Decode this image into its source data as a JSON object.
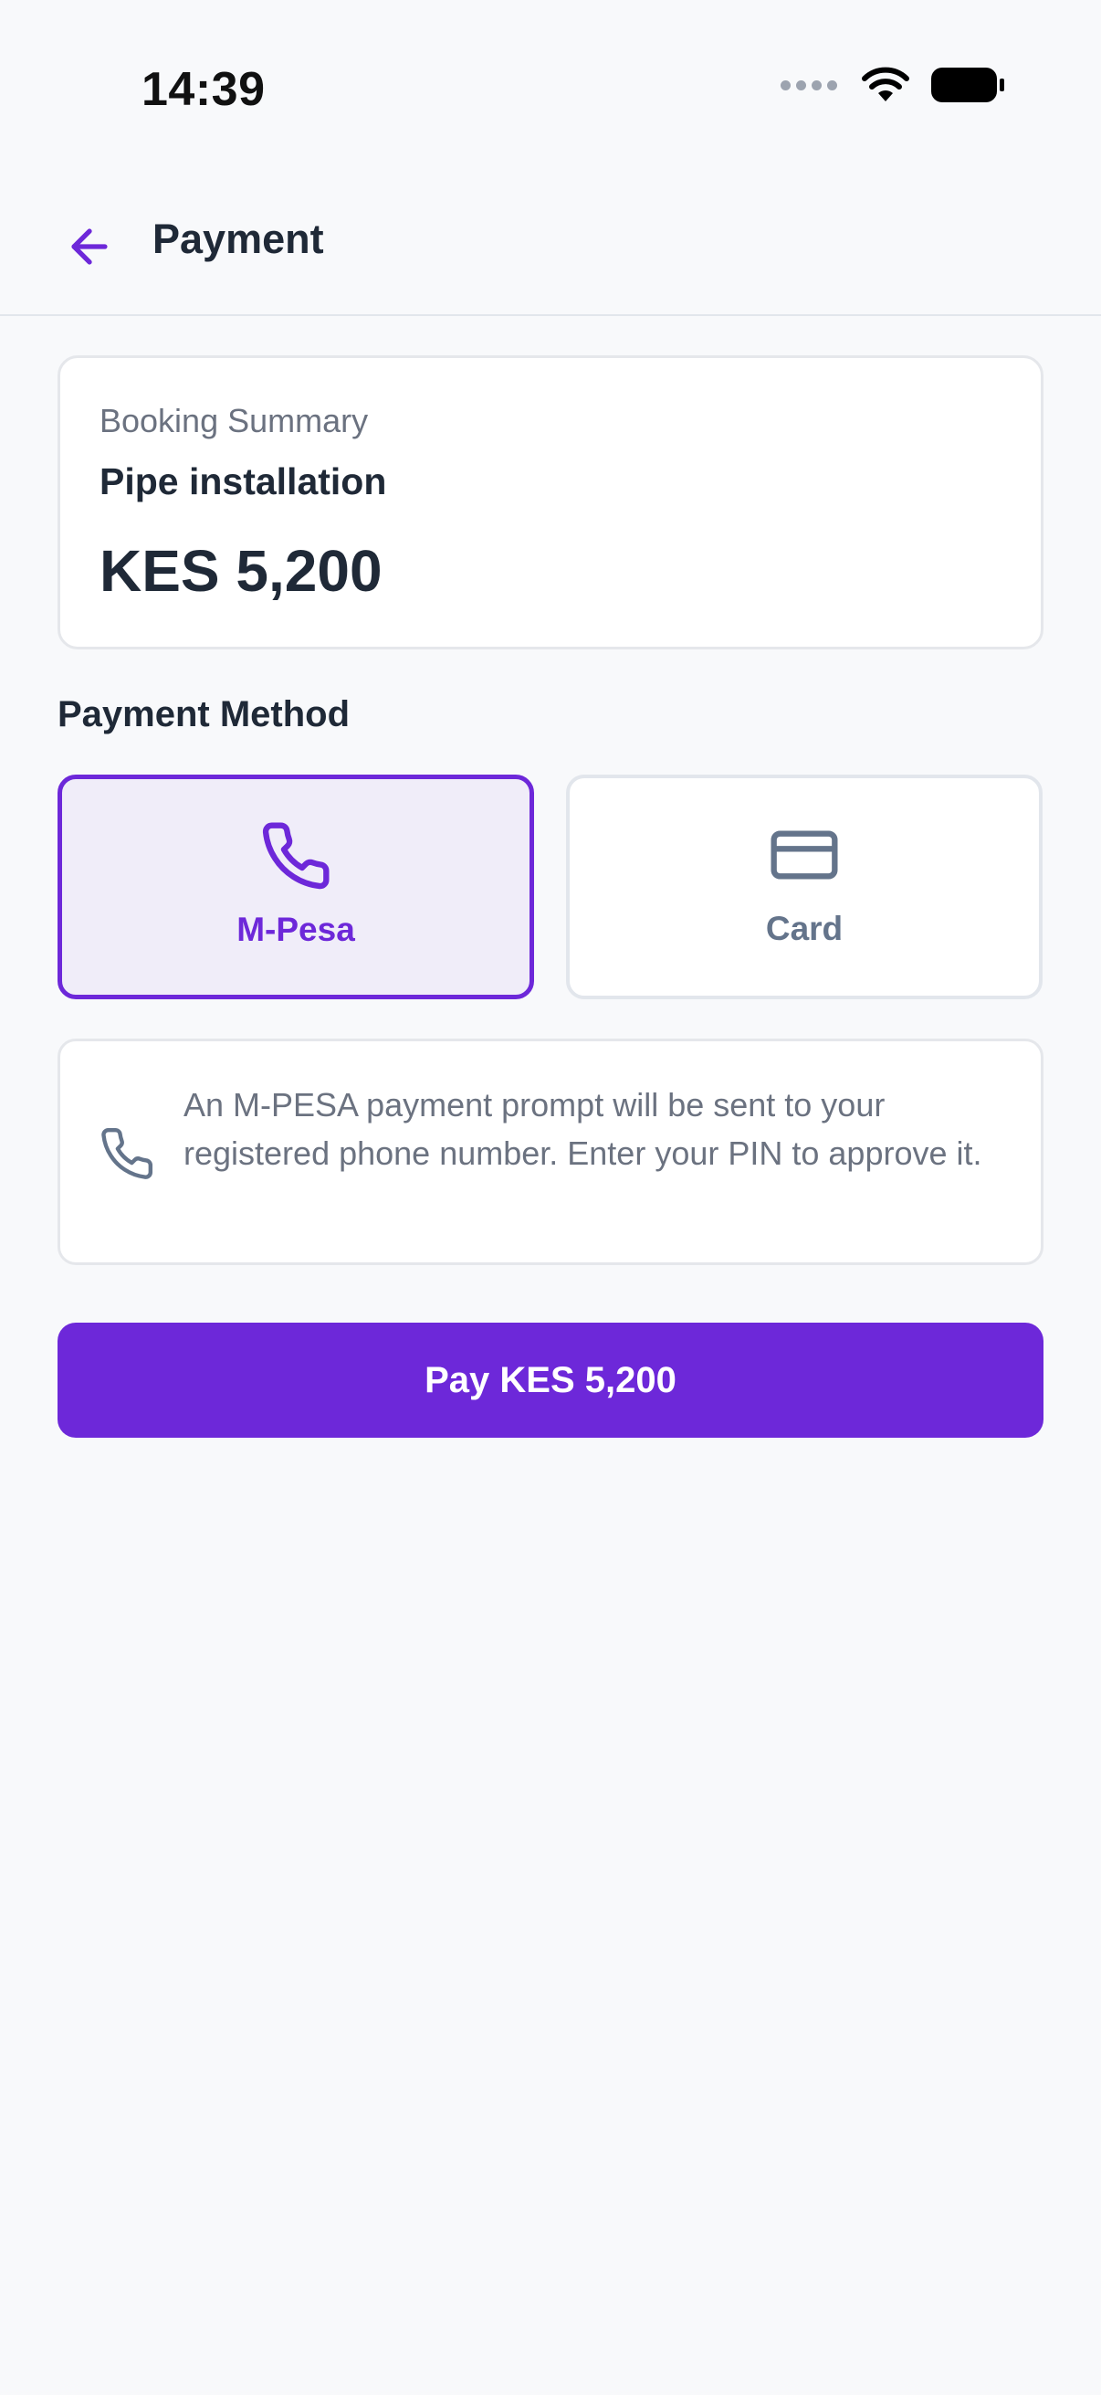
{
  "status_bar": {
    "time": "14:39",
    "icons": [
      "signal-icon",
      "wifi-icon",
      "battery-icon"
    ]
  },
  "header": {
    "title": "Payment",
    "back_icon": "arrow-left-icon"
  },
  "booking_summary": {
    "label": "Booking Summary",
    "service": "Pipe installation",
    "amount": "KES 5,200"
  },
  "payment_method": {
    "title": "Payment Method",
    "selected": "M-Pesa",
    "options": [
      {
        "label": "M-Pesa",
        "icon": "phone-icon",
        "selected": true
      },
      {
        "label": "Card",
        "icon": "credit-card-icon",
        "selected": false
      }
    ]
  },
  "info": {
    "icon": "phone-icon",
    "text": "An M-PESA payment prompt will be sent to your registered phone number. Enter your PIN to approve it."
  },
  "pay_button": {
    "label": "Pay KES 5,200"
  },
  "colors": {
    "accent": "#6D28D9",
    "selected_bg": "#F0EDF9",
    "background": "#F8F9FB",
    "muted_text": "#6B7280"
  }
}
